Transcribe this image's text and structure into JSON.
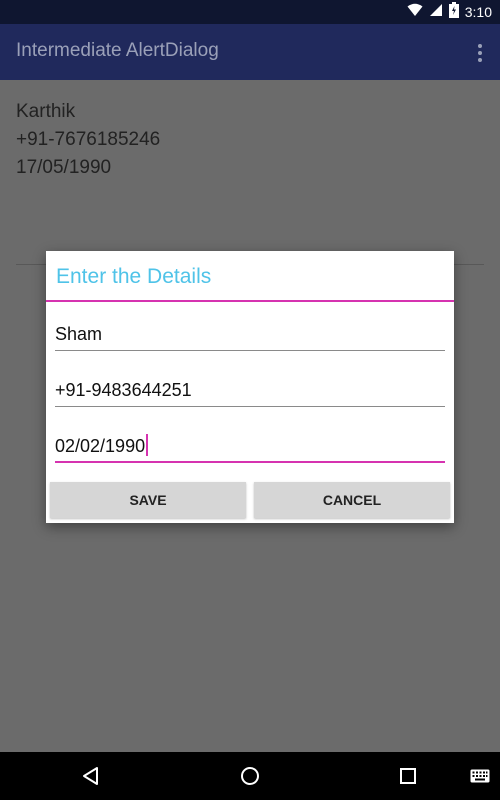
{
  "status_bar": {
    "time": "3:10",
    "icons": [
      "wifi-icon",
      "signal-icon",
      "battery-icon"
    ]
  },
  "app_bar": {
    "title": "Intermediate AlertDialog",
    "overflow_icon": "more-vert-icon"
  },
  "list": {
    "items": [
      {
        "name": "Karthik",
        "phone": "+91-7676185246",
        "dob": "17/05/1990"
      }
    ]
  },
  "dialog": {
    "title": "Enter the Details",
    "fields": [
      {
        "value": "Sham"
      },
      {
        "value": "+91-9483644251"
      },
      {
        "value": "02/02/1990"
      }
    ],
    "buttons": {
      "save": "SAVE",
      "cancel": "CANCEL"
    }
  },
  "nav_bar": {
    "icons": [
      "back-icon",
      "home-icon",
      "recents-icon",
      "keyboard-icon"
    ]
  },
  "colors": {
    "app_bar": "#20295c",
    "status_bar": "#0f1630",
    "accent": "#d633b0",
    "dialog_title": "#4fc3e8",
    "scrim": "#6b6b6b"
  }
}
